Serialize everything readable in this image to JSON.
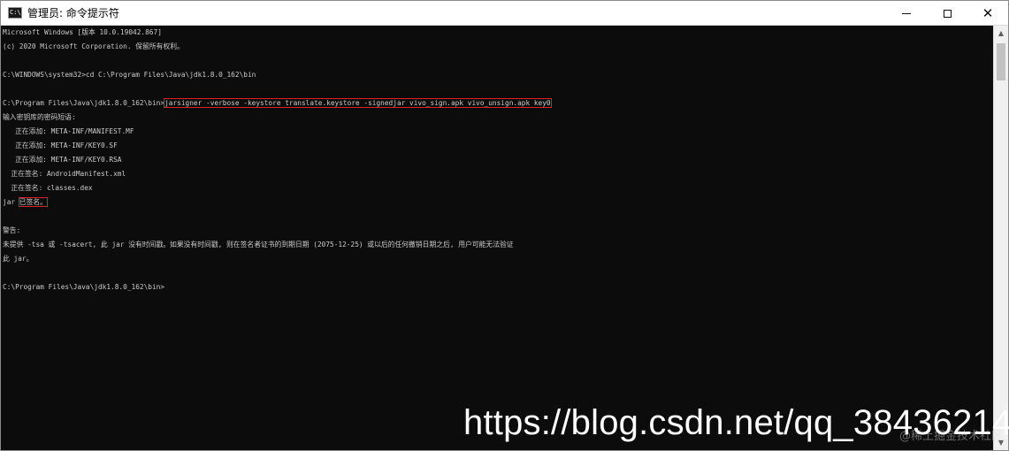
{
  "window": {
    "title": "管理员: 命令提示符",
    "icon": "cmd-icon",
    "icon_text": "C:\\.",
    "controls": {
      "minimize": "minimize-icon",
      "maximize": "maximize-icon",
      "close": "close-icon",
      "close_glyph": "✕"
    }
  },
  "console": {
    "lines": [
      "Microsoft Windows [版本 10.0.19042.867]",
      "(c) 2020 Microsoft Corporation. 保留所有权利。",
      "",
      "C:\\WINDOWS\\system32>cd C:\\Program Files\\Java\\jdk1.8.0_162\\bin",
      "",
      "C:\\Program Files\\Java\\jdk1.8.0_162\\bin>",
      "输入密钥库的密码短语:",
      "   正在添加: META-INF/MANIFEST.MF",
      "   正在添加: META-INF/KEY0.SF",
      "   正在添加: META-INF/KEY0.RSA",
      "  正在签名: AndroidManifest.xml",
      "  正在签名: classes.dex",
      "jar ",
      "",
      "警告:",
      "未提供 -tsa 或 -tsacert, 此 jar 没有时间戳。如果没有时间戳, 则在签名者证书的到期日期 (2075-12-25) 或以后的任何撤销日期之后, 用户可能无法验证",
      "此 jar。",
      "",
      "C:\\Program Files\\Java\\jdk1.8.0_162\\bin>"
    ],
    "command": "jarsigner -verbose -keystore translate.keystore -signedjar vivo_sign.apk vivo_unsign.apk key0",
    "signed_status": "已签名。"
  },
  "scrollbar": {
    "up": "▲",
    "down": "▼"
  },
  "watermark": {
    "url": "https://blog.csdn.net/qq_38436214",
    "community": "@稀土掘金技术社区"
  },
  "colors": {
    "console_bg": "#0c0c0c",
    "console_text": "#cccccc",
    "highlight": "#e02020"
  }
}
